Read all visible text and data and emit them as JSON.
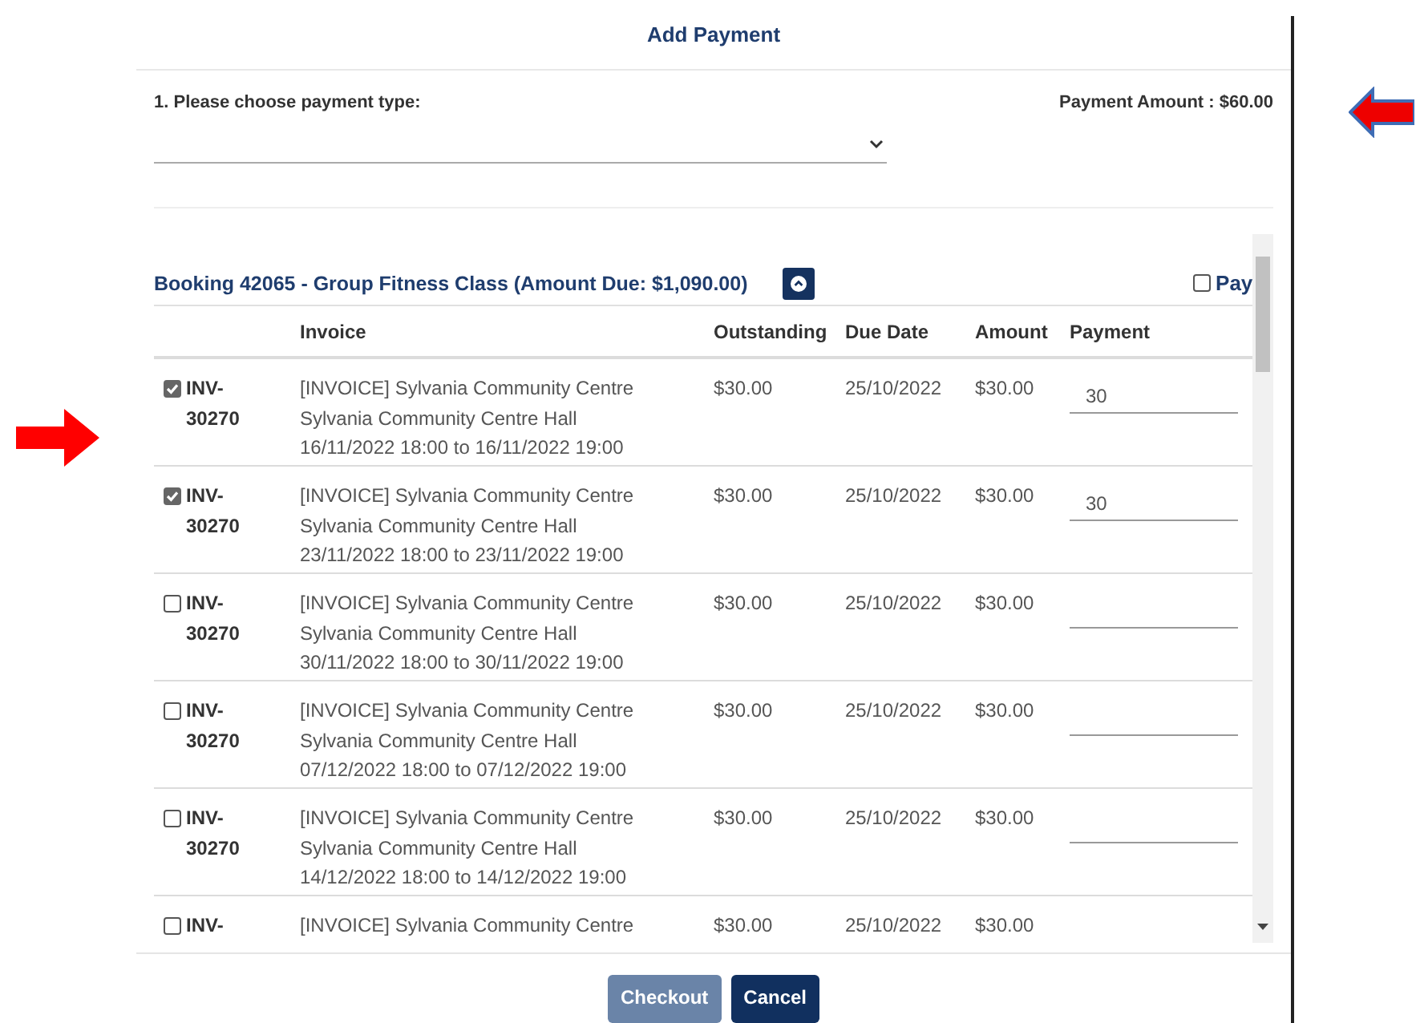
{
  "dialog": {
    "title": "Add Payment"
  },
  "payment_type": {
    "label": "1. Please choose payment type:"
  },
  "payment_amount": "Payment Amount : $60.00",
  "booking": {
    "title": "Booking 42065 - Group Fitness Class (Amount Due: $1,090.00)",
    "expanded": true,
    "pay_label": "Pay",
    "pay_checked": false
  },
  "table": {
    "columns": [
      "Invoice",
      "Outstanding",
      "Due Date",
      "Amount",
      "Payment"
    ],
    "rows": [
      {
        "checked": true,
        "invoice": "INV-30270",
        "description": [
          "[INVOICE] Sylvania Community Centre",
          "Sylvania Community Centre Hall",
          "16/11/2022 18:00 to 16/11/2022 19:00"
        ],
        "outstanding": "$30.00",
        "due_date": "25/10/2022",
        "amount": "$30.00",
        "payment": "30"
      },
      {
        "checked": true,
        "invoice": "INV-30270",
        "description": [
          "[INVOICE] Sylvania Community Centre",
          "Sylvania Community Centre Hall",
          "23/11/2022 18:00 to 23/11/2022 19:00"
        ],
        "outstanding": "$30.00",
        "due_date": "25/10/2022",
        "amount": "$30.00",
        "payment": "30"
      },
      {
        "checked": false,
        "invoice": "INV-30270",
        "description": [
          "[INVOICE] Sylvania Community Centre",
          "Sylvania Community Centre Hall",
          "30/11/2022 18:00 to 30/11/2022 19:00"
        ],
        "outstanding": "$30.00",
        "due_date": "25/10/2022",
        "amount": "$30.00"
      },
      {
        "checked": false,
        "invoice": "INV-30270",
        "description": [
          "[INVOICE] Sylvania Community Centre",
          "Sylvania Community Centre Hall",
          "07/12/2022 18:00 to 07/12/2022 19:00"
        ],
        "outstanding": "$30.00",
        "due_date": "25/10/2022",
        "amount": "$30.00"
      },
      {
        "checked": false,
        "invoice": "INV-30270",
        "description": [
          "[INVOICE] Sylvania Community Centre",
          "Sylvania Community Centre Hall",
          "14/12/2022 18:00 to 14/12/2022 19:00"
        ],
        "outstanding": "$30.00",
        "due_date": "25/10/2022",
        "amount": "$30.00"
      },
      {
        "checked": false,
        "invoice": "INV-",
        "description": [
          "[INVOICE] Sylvania Community Centre"
        ],
        "outstanding": "$30.00",
        "due_date": "25/10/2022",
        "amount": "$30.00"
      }
    ]
  },
  "buttons": [
    {
      "label": "Checkout",
      "disabled": true
    },
    {
      "label": "Cancel",
      "disabled": false
    }
  ]
}
